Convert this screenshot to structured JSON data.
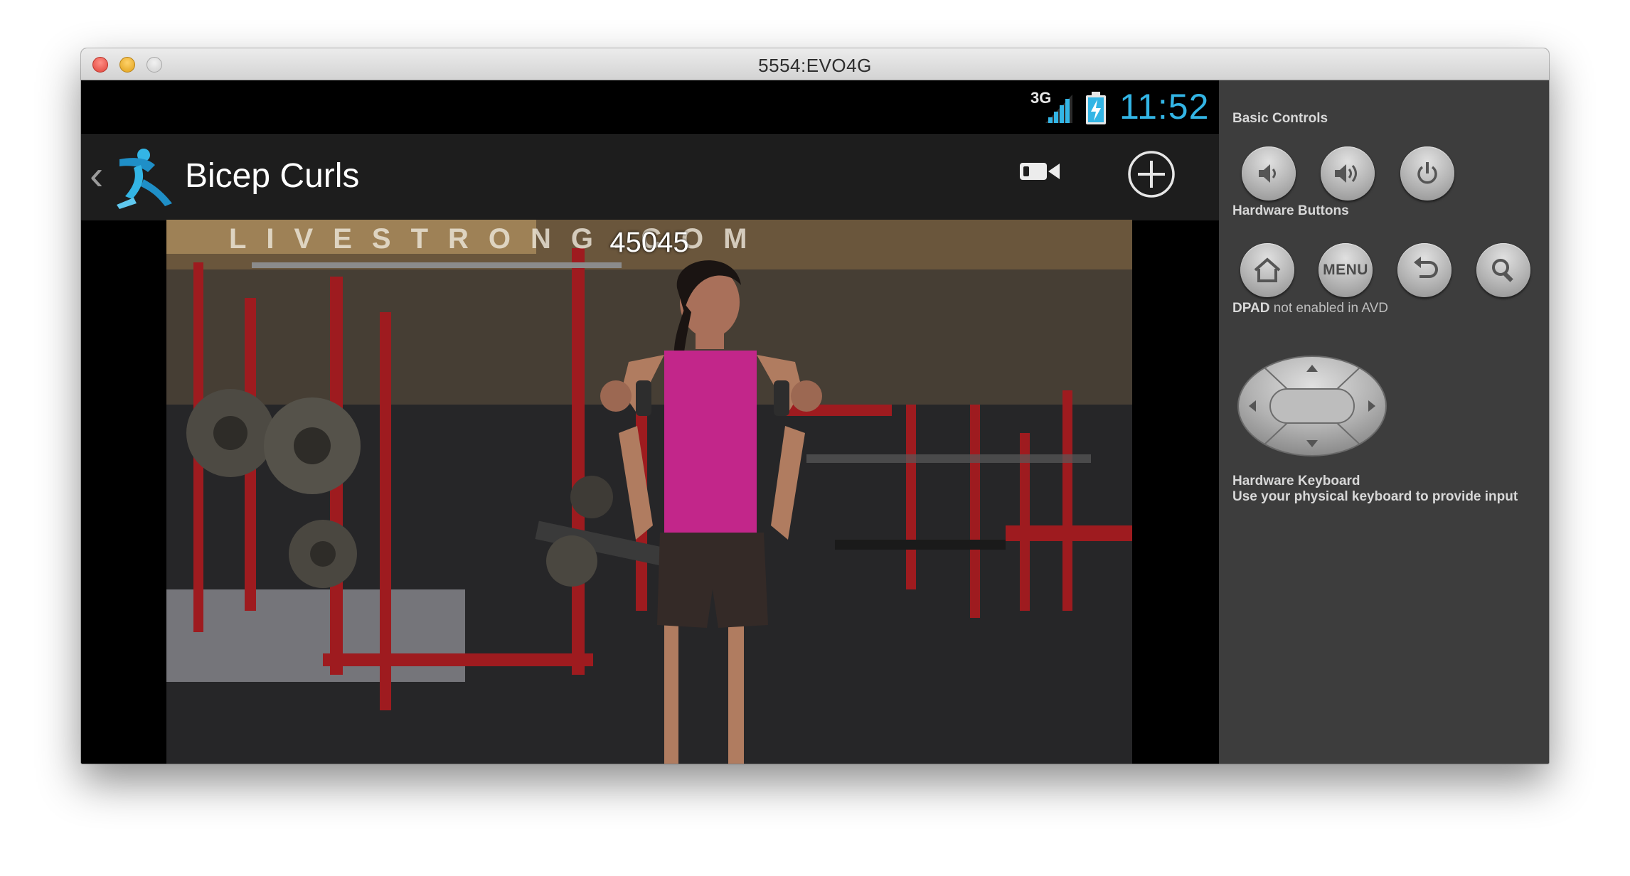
{
  "window": {
    "title": "5554:EVO4G"
  },
  "statusbar": {
    "network": "3G",
    "time": "11:52",
    "time_color": "#33b5e5"
  },
  "actionbar": {
    "title": "Bicep Curls",
    "icons": [
      "back-chevron-icon",
      "app-logo-icon",
      "video-camera-icon",
      "add-circle-icon"
    ]
  },
  "video": {
    "overlay_text": "45045",
    "watermark": "LIVESTRONG.COM"
  },
  "controls": {
    "basic_controls_label": "Basic Controls",
    "basic_buttons": [
      "volume-down-icon",
      "volume-up-icon",
      "power-icon"
    ],
    "hardware_buttons_label": "Hardware Buttons",
    "menu_label": "MENU",
    "hardware_buttons": [
      "home-icon",
      "menu",
      "back-arrow-icon",
      "search-icon"
    ],
    "dpad_label_bold": "DPAD",
    "dpad_label_rest": " not enabled in AVD",
    "keyboard_label": "Hardware Keyboard",
    "keyboard_desc": "Use your physical keyboard to provide input"
  }
}
